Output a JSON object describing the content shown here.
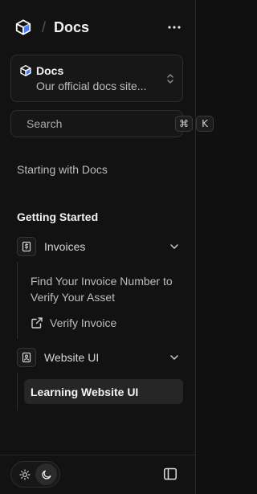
{
  "header": {
    "title": "Docs",
    "logo_icon": "cube-logo-icon",
    "more_icon": "more-horizontal-icon"
  },
  "project_selector": {
    "name": "Docs",
    "description": "Our official docs site...",
    "chevron_icon": "chevrons-up-down-icon"
  },
  "search": {
    "placeholder": "Search",
    "shortcut_keys": [
      "⌘",
      "K"
    ]
  },
  "nav": {
    "top_link": "Starting with Docs",
    "section_title": "Getting Started",
    "groups": [
      {
        "label": "Invoices",
        "icon": "dollar-file-icon",
        "expanded": true,
        "items": [
          {
            "label": "Find Your Invoice Number to Verify Your Asset"
          },
          {
            "label": "Verify Invoice",
            "icon": "external-link-icon"
          }
        ]
      },
      {
        "label": "Website UI",
        "icon": "id-card-icon",
        "expanded": true,
        "items": [
          {
            "label": "Learning Website UI",
            "active": true
          }
        ]
      }
    ]
  },
  "footer": {
    "theme_options": [
      "light",
      "dark"
    ],
    "theme_selected": "dark",
    "toggle_icon": "sidebar-panel-icon"
  },
  "colors": {
    "background": "#121212",
    "border": "#2d2d2d",
    "active_bg": "#262626",
    "text_primary": "#f2f2f2",
    "text_secondary": "#bdbdbd",
    "logo_blue": "#4a7dff"
  }
}
